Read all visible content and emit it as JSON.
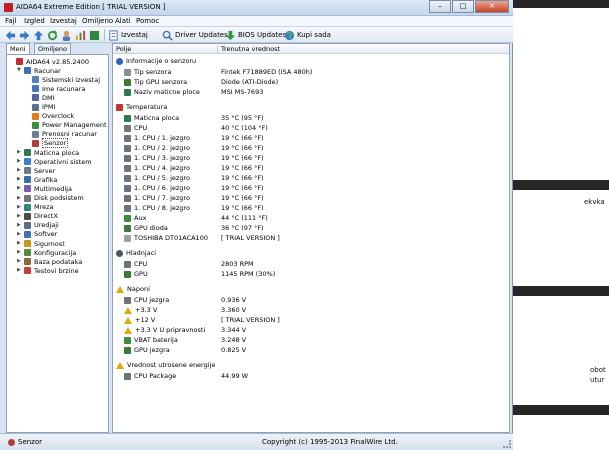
{
  "window": {
    "title": "AIDA64 Extreme Edition  [ TRIAL VERSION ]",
    "minimize": "–",
    "maximize": "□",
    "close": "✕"
  },
  "menu": [
    "Fajl",
    "Izgled",
    "Izvestaj",
    "Omiljeno",
    "Alati",
    "Pomoc"
  ],
  "toolbar": {
    "report": "Izvestaj",
    "driver_updates": "Driver Updates",
    "bios_updates": "BIOS Updates",
    "buy": "Kupi sada"
  },
  "tabs": [
    "Meni",
    "Omiljeno"
  ],
  "tree": [
    {
      "label": "AIDA64 v2.85.2400",
      "icon": "red-64-icon",
      "color": "#c62a2a",
      "exp": "",
      "indent": 0
    },
    {
      "label": "Racunar",
      "icon": "computer-icon",
      "color": "#3f6fb5",
      "exp": "▼",
      "indent": 1
    },
    {
      "label": "Sistemski izvestaj",
      "icon": "report-icon",
      "color": "#5b7fba",
      "exp": "",
      "indent": 2
    },
    {
      "label": "Ime racunara",
      "icon": "computer-icon",
      "color": "#4a77b8",
      "exp": "",
      "indent": 2
    },
    {
      "label": "DMI",
      "icon": "dmi-icon",
      "color": "#5469a4",
      "exp": "",
      "indent": 2
    },
    {
      "label": "IPMI",
      "icon": "ipmi-icon",
      "color": "#57728f",
      "exp": "",
      "indent": 2
    },
    {
      "label": "Overclock",
      "icon": "overclock-icon",
      "color": "#e07c20",
      "exp": "",
      "indent": 2
    },
    {
      "label": "Power Management",
      "icon": "power-icon",
      "color": "#3b8f3b",
      "exp": "",
      "indent": 2
    },
    {
      "label": "Prenosni racunar",
      "icon": "laptop-icon",
      "color": "#6b7f95",
      "exp": "",
      "indent": 2
    },
    {
      "label": "Senzor",
      "icon": "sensor-icon",
      "color": "#b23b3b",
      "exp": "",
      "indent": 2,
      "selected": true
    },
    {
      "label": "Maticna ploca",
      "icon": "motherboard-icon",
      "color": "#2d7b4d",
      "exp": "▶",
      "indent": 1
    },
    {
      "label": "Operativni sistem",
      "icon": "windows-icon",
      "color": "#3c7fd1",
      "exp": "▶",
      "indent": 1
    },
    {
      "label": "Server",
      "icon": "server-icon",
      "color": "#6a7a8c",
      "exp": "▶",
      "indent": 1
    },
    {
      "label": "Grafika",
      "icon": "display-icon",
      "color": "#3a6ea5",
      "exp": "▶",
      "indent": 1
    },
    {
      "label": "Multimedija",
      "icon": "multimedia-icon",
      "color": "#7a5aa8",
      "exp": "▶",
      "indent": 1
    },
    {
      "label": "Disk podsistem",
      "icon": "disk-icon",
      "color": "#70757c",
      "exp": "▶",
      "indent": 1
    },
    {
      "label": "Mreza",
      "icon": "network-icon",
      "color": "#2f8a7a",
      "exp": "▶",
      "indent": 1
    },
    {
      "label": "DirectX",
      "icon": "directx-icon",
      "color": "#4b4b4b",
      "exp": "▶",
      "indent": 1
    },
    {
      "label": "Uredjaji",
      "icon": "devices-icon",
      "color": "#5d6e82",
      "exp": "▶",
      "indent": 1
    },
    {
      "label": "Softver",
      "icon": "software-icon",
      "color": "#3e76b0",
      "exp": "▶",
      "indent": 1
    },
    {
      "label": "Sigurnost",
      "icon": "security-icon",
      "color": "#c49a1e",
      "exp": "▶",
      "indent": 1
    },
    {
      "label": "Konfiguracija",
      "icon": "config-icon",
      "color": "#4f8a3d",
      "exp": "▶",
      "indent": 1
    },
    {
      "label": "Baza podataka",
      "icon": "database-icon",
      "color": "#8a6b3c",
      "exp": "▶",
      "indent": 1
    },
    {
      "label": "Testovi brzine",
      "icon": "benchmark-icon",
      "color": "#c83c3c",
      "exp": "▶",
      "indent": 1
    }
  ],
  "columns": {
    "field": "Polje",
    "value": "Trenutna vrednost"
  },
  "rows": [
    {
      "type": "section",
      "label": "Informacije o senzoru",
      "icon": "info-icon",
      "color": "#2e63b8"
    },
    {
      "type": "item",
      "label": "Tip senzora",
      "value": "Fintek F71889ED  (ISA 480h)",
      "icon": "sensor-icon",
      "color": "#8a8f96"
    },
    {
      "type": "item",
      "label": "Tip GPU senzora",
      "value": "Diode  (ATI-Diode)",
      "icon": "gpu-icon",
      "color": "#3b7a3b"
    },
    {
      "type": "item",
      "label": "Naziv maticne ploce",
      "value": "MSI MS-7693",
      "icon": "motherboard-icon",
      "color": "#2d7b4d"
    },
    {
      "type": "gap"
    },
    {
      "type": "section",
      "label": "Temperatura",
      "icon": "thermometer-icon",
      "color": "#c8342c"
    },
    {
      "type": "item",
      "label": "Maticna ploca",
      "value": "35 °C  (95 °F)",
      "icon": "motherboard-icon",
      "color": "#2d7b4d"
    },
    {
      "type": "item",
      "label": "CPU",
      "value": "40 °C  (104 °F)",
      "icon": "cpu-icon",
      "color": "#6d737a"
    },
    {
      "type": "item",
      "label": "1. CPU / 1. jezgro",
      "value": "19 °C  (66 °F)",
      "icon": "cpu-icon",
      "color": "#6d737a"
    },
    {
      "type": "item",
      "label": "1. CPU / 2. jezgro",
      "value": "19 °C  (66 °F)",
      "icon": "cpu-icon",
      "color": "#6d737a"
    },
    {
      "type": "item",
      "label": "1. CPU / 3. jezgro",
      "value": "19 °C  (66 °F)",
      "icon": "cpu-icon",
      "color": "#6d737a"
    },
    {
      "type": "item",
      "label": "1. CPU / 4. jezgro",
      "value": "19 °C  (66 °F)",
      "icon": "cpu-icon",
      "color": "#6d737a"
    },
    {
      "type": "item",
      "label": "1. CPU / 5. jezgro",
      "value": "19 °C  (66 °F)",
      "icon": "cpu-icon",
      "color": "#6d737a"
    },
    {
      "type": "item",
      "label": "1. CPU / 6. jezgro",
      "value": "19 °C  (66 °F)",
      "icon": "cpu-icon",
      "color": "#6d737a"
    },
    {
      "type": "item",
      "label": "1. CPU / 7. jezgro",
      "value": "19 °C  (66 °F)",
      "icon": "cpu-icon",
      "color": "#6d737a"
    },
    {
      "type": "item",
      "label": "1. CPU / 8. jezgro",
      "value": "19 °C  (66 °F)",
      "icon": "cpu-icon",
      "color": "#6d737a"
    },
    {
      "type": "item",
      "label": "Aux",
      "value": "44 °C  (111 °F)",
      "icon": "aux-icon",
      "color": "#3a8c3a"
    },
    {
      "type": "item",
      "label": "GPU dioda",
      "value": "36 °C  (97 °F)",
      "icon": "gpu-icon",
      "color": "#3b7a3b"
    },
    {
      "type": "item",
      "label": "TOSHIBA DT01ACA100",
      "value": "[ TRIAL VERSION ]",
      "icon": "disk-icon",
      "color": "#9aa0a6"
    },
    {
      "type": "gap"
    },
    {
      "type": "section",
      "label": "Hladnjaci",
      "icon": "fan-icon",
      "color": "#4d5560"
    },
    {
      "type": "item",
      "label": "CPU",
      "value": "2803 RPM",
      "icon": "cpu-icon",
      "color": "#6d737a"
    },
    {
      "type": "item",
      "label": "GPU",
      "value": "1145 RPM  (30%)",
      "icon": "gpu-icon",
      "color": "#3b7a3b"
    },
    {
      "type": "gap"
    },
    {
      "type": "section",
      "label": "Naponi",
      "icon": "warning-icon",
      "color": "#e0a80c"
    },
    {
      "type": "item",
      "label": "CPU jezgra",
      "value": "0.936 V",
      "icon": "cpu-icon",
      "color": "#6d737a"
    },
    {
      "type": "item",
      "label": "+3.3 V",
      "value": "3.360 V",
      "icon": "warning-icon",
      "color": "#e0a80c"
    },
    {
      "type": "item",
      "label": "+12 V",
      "value": "[ TRIAL VERSION ]",
      "icon": "warning-icon",
      "color": "#e0a80c"
    },
    {
      "type": "item",
      "label": "+3.3 V U pripravnosti",
      "value": "3.344 V",
      "icon": "warning-icon",
      "color": "#e0a80c"
    },
    {
      "type": "item",
      "label": "VBAT baterija",
      "value": "3.248 V",
      "icon": "battery-icon",
      "color": "#3d8f3d"
    },
    {
      "type": "item",
      "label": "GPU jezgra",
      "value": "0.825 V",
      "icon": "gpu-icon",
      "color": "#3b7a3b"
    },
    {
      "type": "gap"
    },
    {
      "type": "section",
      "label": "Vrednost utrosene energije",
      "icon": "warning-icon",
      "color": "#e0a80c"
    },
    {
      "type": "item",
      "label": "CPU Package",
      "value": "44.99 W",
      "icon": "cpu-icon",
      "color": "#6d737a"
    }
  ],
  "status": {
    "left": "Senzor",
    "center": "Copyright (c) 1995-2013 FinalWire Ltd."
  },
  "background_fragments": [
    "ekvka",
    "obot",
    "utur"
  ]
}
